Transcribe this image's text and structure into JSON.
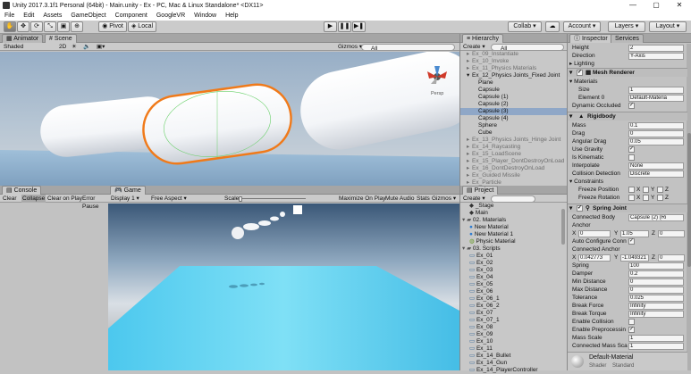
{
  "window": {
    "title": "Unity 2017.3.1f1 Personal (64bit) - Main.unity - Ex - PC, Mac & Linux Standalone* <DX11>",
    "min": "—",
    "max": "▢",
    "close": "✕"
  },
  "menu": [
    "File",
    "Edit",
    "Assets",
    "GameObject",
    "Component",
    "GoogleVR",
    "Window",
    "Help"
  ],
  "toolbar": {
    "pivot": "Pivot",
    "local": "Local",
    "collab": "Collab ▾",
    "account": "Account ▾",
    "layers": "Layers ▾",
    "layout": "Layout ▾"
  },
  "scene": {
    "tabs": [
      "Animator",
      "Scene"
    ],
    "shading": "Shaded",
    "mode2d": "2D",
    "gizmos": "Gizmos ▾",
    "search": "All",
    "persp": "Persp"
  },
  "hierarchy": {
    "tab": "Hierarchy",
    "create": "Create ▾",
    "search": "All",
    "items": [
      {
        "label": "Ex_09_Instantiate",
        "indent": 1,
        "grey": true,
        "arrow": "▸"
      },
      {
        "label": "Ex_10_Invoke",
        "indent": 1,
        "grey": true,
        "arrow": "▸"
      },
      {
        "label": "Ex_11_Physics Materials",
        "indent": 1,
        "grey": true,
        "arrow": "▸"
      },
      {
        "label": "Ex_12_Physics Joints_Fixed Joint",
        "indent": 1,
        "grey": false,
        "arrow": "▾"
      },
      {
        "label": "Plane",
        "indent": 2,
        "grey": false,
        "arrow": ""
      },
      {
        "label": "Capsule",
        "indent": 2,
        "grey": false,
        "arrow": ""
      },
      {
        "label": "Capsule (1)",
        "indent": 2,
        "grey": false,
        "arrow": ""
      },
      {
        "label": "Capsule (2)",
        "indent": 2,
        "grey": false,
        "arrow": ""
      },
      {
        "label": "Capsule (3)",
        "indent": 2,
        "grey": false,
        "arrow": "",
        "selected": true
      },
      {
        "label": "Capsule (4)",
        "indent": 2,
        "grey": false,
        "arrow": ""
      },
      {
        "label": "Sphere",
        "indent": 2,
        "grey": false,
        "arrow": ""
      },
      {
        "label": "Cube",
        "indent": 2,
        "grey": false,
        "arrow": ""
      },
      {
        "label": "Ex_13_Physics Joints_Hinge Joint",
        "indent": 1,
        "grey": true,
        "arrow": "▸"
      },
      {
        "label": "Ex_14_Raycasting",
        "indent": 1,
        "grey": true,
        "arrow": "▸"
      },
      {
        "label": "Ex_15_LoadScene",
        "indent": 1,
        "grey": true,
        "arrow": "▸"
      },
      {
        "label": "Ex_15_Player_DontDestroyOnLoad",
        "indent": 1,
        "grey": true,
        "arrow": "▸"
      },
      {
        "label": "Ex_16_DontDestroyOnLoad",
        "indent": 1,
        "grey": true,
        "arrow": "▸"
      },
      {
        "label": "Ex_Guided Missile",
        "indent": 1,
        "grey": true,
        "arrow": "▸"
      },
      {
        "label": "Ex_Particle",
        "indent": 1,
        "grey": true,
        "arrow": "▸"
      }
    ]
  },
  "console": {
    "tab": "Console",
    "buttons": [
      "Clear",
      "Collapse",
      "Clear on Play",
      "Error Pause"
    ]
  },
  "game": {
    "tab": "Game",
    "display": "Display 1 ▾",
    "aspect": "Free Aspect ▾",
    "scale_label": "Scale",
    "maximize": "Maximize On Play",
    "mute": "Mute Audio",
    "stats": "Stats",
    "gizmos": "Gizmos ▾"
  },
  "project": {
    "tab": "Project",
    "create": "Create ▾",
    "items": [
      {
        "label": "_Stage",
        "indent": 1,
        "kind": "scene"
      },
      {
        "label": "Main",
        "indent": 1,
        "kind": "scene"
      },
      {
        "label": "02. Materials",
        "indent": 0,
        "kind": "folder"
      },
      {
        "label": "New Material",
        "indent": 1,
        "kind": "mat"
      },
      {
        "label": "New Material 1",
        "indent": 1,
        "kind": "mat"
      },
      {
        "label": "Physic Material",
        "indent": 1,
        "kind": "phys"
      },
      {
        "label": "03. Scripts",
        "indent": 0,
        "kind": "folder"
      },
      {
        "label": "Ex_01",
        "indent": 1,
        "kind": "script"
      },
      {
        "label": "Ex_02",
        "indent": 1,
        "kind": "script"
      },
      {
        "label": "Ex_03",
        "indent": 1,
        "kind": "script"
      },
      {
        "label": "Ex_04",
        "indent": 1,
        "kind": "script"
      },
      {
        "label": "Ex_05",
        "indent": 1,
        "kind": "script"
      },
      {
        "label": "Ex_06",
        "indent": 1,
        "kind": "script"
      },
      {
        "label": "Ex_06_1",
        "indent": 1,
        "kind": "script"
      },
      {
        "label": "Ex_06_2",
        "indent": 1,
        "kind": "script"
      },
      {
        "label": "Ex_07",
        "indent": 1,
        "kind": "script"
      },
      {
        "label": "Ex_07_1",
        "indent": 1,
        "kind": "script"
      },
      {
        "label": "Ex_08",
        "indent": 1,
        "kind": "script"
      },
      {
        "label": "Ex_09",
        "indent": 1,
        "kind": "script"
      },
      {
        "label": "Ex_10",
        "indent": 1,
        "kind": "script"
      },
      {
        "label": "Ex_11",
        "indent": 1,
        "kind": "script"
      },
      {
        "label": "Ex_14_Bullet",
        "indent": 1,
        "kind": "script"
      },
      {
        "label": "Ex_14_Gun",
        "indent": 1,
        "kind": "script"
      },
      {
        "label": "Ex_14_PlayerController",
        "indent": 1,
        "kind": "script"
      }
    ]
  },
  "inspector": {
    "tabs": [
      "Inspector",
      "Services"
    ],
    "height": {
      "label": "Height",
      "value": "2"
    },
    "direction": {
      "label": "Direction",
      "value": "Y-Axis"
    },
    "lighting": "Lighting",
    "mesh_renderer": "Mesh Renderer",
    "materials": "Materials",
    "size": {
      "label": "Size",
      "value": "1"
    },
    "element0": {
      "label": "Element 0",
      "value": "Default-Materia"
    },
    "dynamic_occluded": "Dynamic Occluded",
    "rigidbody": "Rigidbody",
    "mass": {
      "label": "Mass",
      "value": "0.1"
    },
    "drag": {
      "label": "Drag",
      "value": "0"
    },
    "angular_drag": {
      "label": "Angular Drag",
      "value": "0.05"
    },
    "use_gravity": "Use Gravity",
    "is_kinematic": "Is Kinematic",
    "interpolate": {
      "label": "Interpolate",
      "value": "None"
    },
    "collision_detection": {
      "label": "Collision Detection",
      "value": "Discrete"
    },
    "constraints": "Constraints",
    "freeze_position": "Freeze Position",
    "freeze_rotation": "Freeze Rotation",
    "xyz": [
      "X",
      "Y",
      "Z"
    ],
    "spring_joint": "Spring Joint",
    "connected_body": {
      "label": "Connected Body",
      "value": "Capsule (2) (Ri"
    },
    "anchor": {
      "label": "Anchor",
      "x": "0",
      "y": "1.05",
      "z": "0"
    },
    "auto_configure": "Auto Configure Conn",
    "connected_anchor": {
      "label": "Connected Anchor",
      "x": "0.042773",
      "y": "-1.049321",
      "z": "0"
    },
    "spring": {
      "label": "Spring",
      "value": "100"
    },
    "damper": {
      "label": "Damper",
      "value": "0.2"
    },
    "min_distance": {
      "label": "Min Distance",
      "value": "0"
    },
    "max_distance": {
      "label": "Max Distance",
      "value": "0"
    },
    "tolerance": {
      "label": "Tolerance",
      "value": "0.025"
    },
    "break_force": {
      "label": "Break Force",
      "value": "Infinity"
    },
    "break_torque": {
      "label": "Break Torque",
      "value": "Infinity"
    },
    "enable_collision": "Enable Collision",
    "enable_preprocessing": "Enable Preprocessin",
    "mass_scale": {
      "label": "Mass Scale",
      "value": "1"
    },
    "connected_mass_scale": {
      "label": "Connected Mass Sca",
      "value": "1"
    },
    "default_material": "Default-Material",
    "shader": {
      "label": "Shader",
      "value": "Standard"
    }
  }
}
